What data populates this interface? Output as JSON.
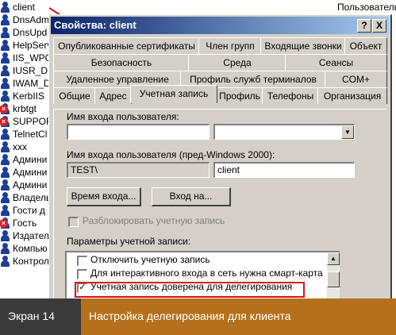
{
  "background": {
    "header": "Пользователь",
    "items": [
      {
        "name": "client",
        "icon": "user-icon"
      },
      {
        "name": "DnsAdm",
        "icon": "user-icon"
      },
      {
        "name": "DnsUpd",
        "icon": "user-icon"
      },
      {
        "name": "HelpServ",
        "icon": "user-icon"
      },
      {
        "name": "IIS_WPG",
        "icon": "user-icon"
      },
      {
        "name": "IUSR_D",
        "icon": "user-icon"
      },
      {
        "name": "IWAM_D",
        "icon": "user-icon"
      },
      {
        "name": "KerbIIS",
        "icon": "user-icon"
      },
      {
        "name": "krbtgt",
        "icon": "disabled-user-icon"
      },
      {
        "name": "SUPPORT",
        "icon": "disabled-user-icon"
      },
      {
        "name": "TelnetCl",
        "icon": "user-icon"
      },
      {
        "name": "xxx",
        "icon": "user-icon"
      },
      {
        "name": "Админи",
        "icon": "user-icon"
      },
      {
        "name": "Админи",
        "icon": "user-icon"
      },
      {
        "name": "Админи",
        "icon": "user-icon"
      },
      {
        "name": "Владель",
        "icon": "user-icon"
      },
      {
        "name": "Гости д",
        "icon": "user-icon"
      },
      {
        "name": "Гость",
        "icon": "disabled-user-icon"
      },
      {
        "name": "Издател",
        "icon": "user-icon"
      },
      {
        "name": "Компью",
        "icon": "user-icon"
      },
      {
        "name": "Контрол",
        "icon": "user-icon"
      }
    ]
  },
  "dialog": {
    "title": "Свойства: client",
    "help_button": "?",
    "close_button": "X",
    "tabs_row1": [
      "Опубликованные сертификаты",
      "Член групп",
      "Входящие звонки",
      "Объект"
    ],
    "tabs_row2": [
      "Безопасность",
      "Среда",
      "Сеансы"
    ],
    "tabs_row3": [
      "Удаленное управление",
      "Профиль служб терминалов",
      "COM+"
    ],
    "tabs_row4": [
      "Общие",
      "Адрес",
      "Учетная запись",
      "Профиль",
      "Телефоны",
      "Организация"
    ],
    "active_tab": "Учетная запись",
    "logon_name_label": "Имя входа пользователя:",
    "logon_name_value": "",
    "domain_value": "",
    "pre2000_label": "Имя входа пользователя (пред-Windows 2000):",
    "pre2000_domain": "TEST\\",
    "pre2000_name": "client",
    "logon_hours_button": "Время входа...",
    "logon_to_button": "Вход на...",
    "unlock_label": "Разблокировать учетную запись",
    "account_options_label": "Параметры учетной записи:",
    "options": [
      {
        "label": "Отключить учетную запись",
        "checked": false
      },
      {
        "label": "Для интерактивного входа в сеть нужна смарт-карта",
        "checked": false
      },
      {
        "label": "Учетная запись доверена для делегирования",
        "checked": true
      }
    ]
  },
  "caption": {
    "left": "Экран 14",
    "right": "Настройка делегирования для клиента",
    "left_color": "#3a3a3a",
    "right_color": "#b5701c"
  },
  "colors": {
    "title_gradient_start": "#0a246a",
    "dialog_face": "#d4d0c8",
    "highlight_red": "#dd1111"
  }
}
